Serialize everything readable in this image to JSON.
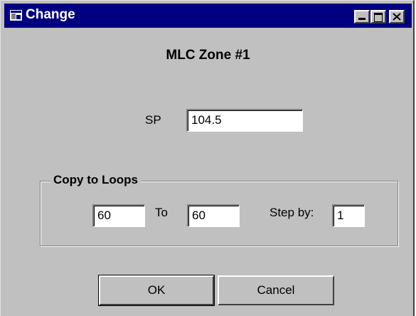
{
  "window": {
    "title": "Change",
    "icon": "app-window-icon",
    "controls": [
      "minimize-icon",
      "maximize-icon",
      "close-icon"
    ]
  },
  "heading": "MLC  Zone #1",
  "setpoint": {
    "label": "SP",
    "value": "104.5"
  },
  "copy_to_loops": {
    "group_label": "Copy to Loops",
    "from_value": "60",
    "to_label": "To",
    "to_value": "60",
    "step_label": "Step by:",
    "step_value": "1"
  },
  "buttons": {
    "ok_label": "OK",
    "cancel_label": "Cancel"
  },
  "colors": {
    "title_bar": "#000080",
    "face": "#c0c0c0",
    "field": "#ffffff"
  }
}
